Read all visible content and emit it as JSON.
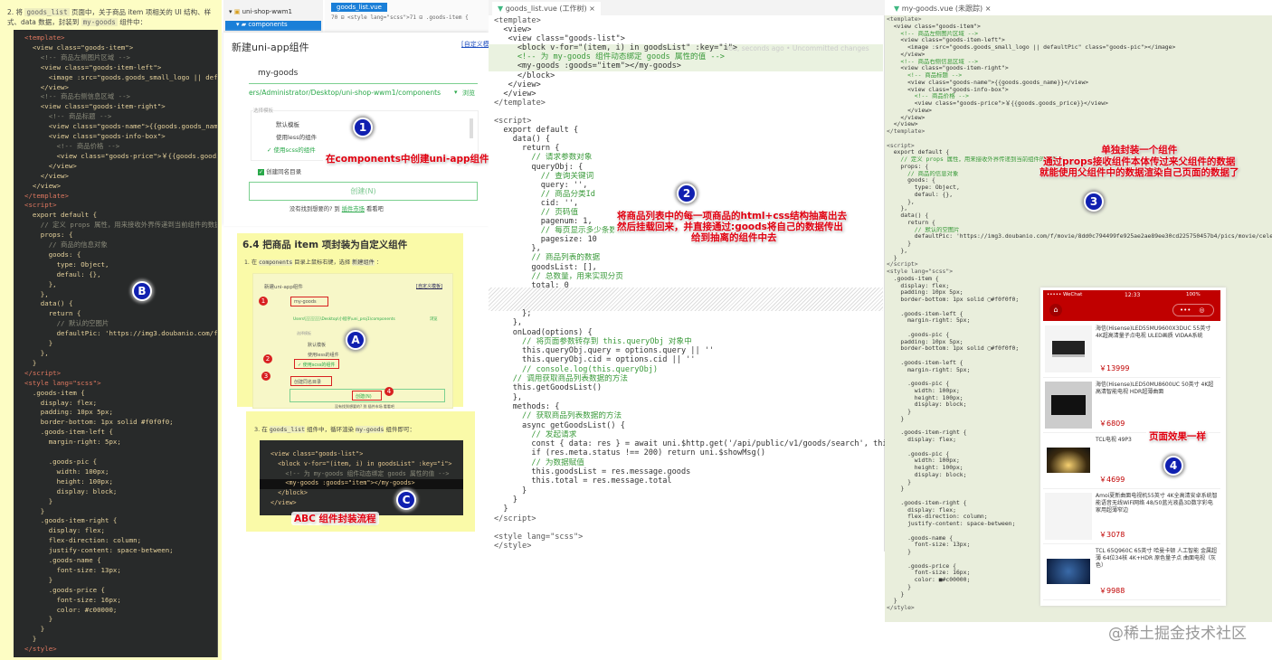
{
  "panel_b": {
    "intro_prefix": "2. 将",
    "intro_code1": "goods_list",
    "intro_mid": "页面中，关于商品 item 项相关的 UI 结构、样式、data 数据，封装到",
    "intro_code2": "my-goods",
    "intro_suffix": "组件中：",
    "badge": "B",
    "code": [
      "<template>",
      "  <view class=\"goods-item\">",
      "    <!-- 商品左侧图片区域 -->",
      "    <view class=\"goods-item-left\">",
      "      <image :src=\"goods.goods_small_logo || defaultPic\" class=\"goods-pic\"></image>",
      "    </view>",
      "    <!-- 商品右侧信息区域 -->",
      "    <view class=\"goods-item-right\">",
      "      <!-- 商品标题 -->",
      "      <view class=\"goods-name\">{{goods.goods_name}}</view>",
      "      <view class=\"goods-info-box\">",
      "        <!-- 商品价格 -->",
      "        <view class=\"goods-price\">￥{{goods.goods_price}}</view>",
      "      </view>",
      "    </view>",
      "  </view>",
      "</template>",
      "<script>",
      "  export default {",
      "    // 定义 props 属性，用来接收外界传递到当前组件的数据",
      "    props: {",
      "      // 商品的信息对象",
      "      goods: {",
      "        type: Object,",
      "        defaul: {},",
      "      },",
      "    },",
      "    data() {",
      "      return {",
      "        // 默认的空图片",
      "        defaultPic: 'https://img3.doubanio.com/f/movie/...'",
      "      }",
      "    },",
      "  }",
      "</script>",
      "<style lang=\"scss\">",
      "  .goods-item {",
      "    display: flex;",
      "    padding: 10px 5px;",
      "    border-bottom: 1px solid #f0f0f0;",
      "    .goods-item-left {",
      "      margin-right: 5px;",
      "",
      "      .goods-pic {",
      "        width: 100px;",
      "        height: 100px;",
      "        display: block;",
      "      }",
      "    }",
      "    .goods-item-right {",
      "      display: flex;",
      "      flex-direction: column;",
      "      justify-content: space-between;",
      "      .goods-name {",
      "        font-size: 13px;",
      "      }",
      "      .goods-price {",
      "        font-size: 16px;",
      "        color: #c00000;",
      "      }",
      "    }",
      "  }",
      "</style>"
    ]
  },
  "panel_1": {
    "project": "uni-shop-wwm1",
    "folder": "components",
    "file_tab": "goods_list.vue",
    "bg_code": [
      "70 ⊟ <style lang=\"scss\">",
      "71 ⊟ .goods-item {"
    ],
    "dialog_title": "新建uni-app组件",
    "custom_template": "[自定义模板]",
    "name_value": "my-goods",
    "path_value": "ers/Administrator/Desktop/uni-shop-wwm1/components",
    "browse": "浏览",
    "template_legend": "选择模板",
    "templates": [
      "默认模板",
      "使用less的组件",
      "使用scss的组件"
    ],
    "selected_mark": "✓",
    "checkbox_label": "创建同名目录",
    "create_button": "创建(N)",
    "footer_prefix": "没有找到想要的? 到",
    "footer_link": "插件市场",
    "footer_suffix": "看看吧",
    "badge": "1",
    "callout": "在components中创建uni-app组件"
  },
  "panel_a": {
    "heading": "6.4 把商品 item 项封装为自定义组件",
    "step_prefix": "1. 在",
    "step_code1": "components",
    "step_mid": "目录上鼠标右键，选择",
    "step_code2": "新建组件",
    "step_suffix": "：",
    "dialog_title": "新建uni-app组件",
    "custom_template": "[自定义模板]",
    "name_value": "my-goods",
    "path_value": "Users\\░░░░░\\Desktop\\小程序\\uni_proj1\\components",
    "browse": "浏览",
    "template_legend": "选择模板",
    "templates": [
      "默认模板",
      "使用less的组件",
      "✓ 使用scss的组件"
    ],
    "checkbox_label": "创建同名目录",
    "create_button": "创建(N)",
    "footer": "没有找到想要的? 到 插件市场 看看吧",
    "markers": [
      "1",
      "2",
      "3",
      "4"
    ],
    "badge": "A"
  },
  "panel_c": {
    "step_prefix": "3. 在",
    "step_code1": "goods_list",
    "step_mid": "组件中，循环渲染",
    "step_code2": "my-goods",
    "step_suffix": "组件即可：",
    "code": [
      "<view class=\"goods-list\">",
      "  <block v-for=\"(item, i) in goodsList\" :key=\"i\">",
      "    <!-- 为 my-goods 组件动态绑定 goods 属性的值 -->",
      "    <my-goods :goods=\"item\"></my-goods>",
      "  </block>",
      "</view>"
    ],
    "badge": "C",
    "callout_abc": "ABC",
    "callout": "组件封装流程"
  },
  "panel_2": {
    "tab": "goods_list.vue (工作树)",
    "blame": "You, seconds ago • Uncommitted changes",
    "code_top": [
      "<template>",
      "  <view>",
      "   <view class=\"goods-list\">",
      "     <block v-for=\"(item, i) in goodsList\" :key=\"i\">",
      "     <!-- 为 my-goods 组件动态绑定 goods 属性的值 -->",
      "     <my-goods :goods=\"item\"></my-goods>",
      "     </block>",
      "   </view>",
      "  </view>",
      "</template>",
      "",
      "<script>",
      "  export default {",
      "    data() {",
      "      return {",
      "        // 请求参数对象",
      "        queryObj: {",
      "          // 查询关键词",
      "          query: '',",
      "          // 商品分类Id",
      "          cid: '',",
      "          // 页码值",
      "          pagenum: 1,",
      "          // 每页显示多少条数据",
      "          pagesize: 10",
      "        },",
      "        // 商品列表的数据",
      "        goodsList: [],",
      "        // 总数量，用来实现分页",
      "        total: 0"
    ],
    "code_bottom": [
      "      };",
      "    },",
      "    onLoad(options) {",
      "      // 将页面参数转存到 this.queryObj 对象中",
      "      this.queryObj.query = options.query || ''",
      "      this.queryObj.cid = options.cid || ''",
      "      // console.log(this.queryObj)",
      "    // 调用获取商品列表数据的方法",
      "    this.getGoodsList()",
      "    },",
      "    methods: {",
      "      // 获取商品列表数据的方法",
      "      async getGoodsList() {",
      "        // 发起请求",
      "        const { data: res } = await uni.$http.get('/api/public/v1/goods/search', this.queryObj)",
      "        if (res.meta.status !== 200) return uni.$showMsg()",
      "        // 为数据赋值",
      "        this.goodsList = res.message.goods",
      "        this.total = res.message.total",
      "      }",
      "    }",
      "  }",
      "</script>",
      "",
      "<style lang=\"scss\">",
      "</style>"
    ],
    "badge": "2",
    "callout": [
      "将商品列表中的每一项商品的html+css结构抽离出去",
      "然后挂载回来，并直接通过:goods将自己的数据传出",
      "给到抽离的组件中去"
    ]
  },
  "panel_3": {
    "tab": "my-goods.vue (未跟踪)",
    "code": [
      "<template>",
      "  <view class=\"goods-item\">",
      "    <!-- 商品左侧图片区域 -->",
      "    <view class=\"goods-item-left\">",
      "      <image :src=\"goods.goods_small_logo || defaultPic\" class=\"goods-pic\"></image>",
      "    </view>",
      "    <!-- 商品右侧信息区域 -->",
      "    <view class=\"goods-item-right\">",
      "      <!-- 商品标题 -->",
      "      <view class=\"goods-name\">{{goods.goods_name}}</view>",
      "      <view class=\"goods-info-box\">",
      "        <!-- 商品价格 -->",
      "        <view class=\"goods-price\">￥{{goods.goods_price}}</view>",
      "      </view>",
      "    </view>",
      "  </view>",
      "</template>",
      "",
      "<script>",
      "  export default {",
      "    // 定义 props 属性，用来接收外界传递到当前组件的数据",
      "    props: {",
      "      // 商品的信息对象",
      "      goods: {",
      "        type: Object,",
      "        defaul: {},",
      "      },",
      "    },",
      "    data() {",
      "      return {",
      "        // 默认的空图片",
      "        defaultPic: 'https://img3.doubanio.com/f/movie/8dd0c794499fe925ae2ae89ee30cd225750457b4/pics/movie/celebrity-default",
      "      }",
      "    },",
      "  }",
      "</script>",
      "<style lang=\"scss\">",
      "  .goods-item {",
      "    display: flex;",
      "    padding: 10px 5px;",
      "    border-bottom: 1px solid ▢#f0f0f0;",
      "",
      "    .goods-item-left {",
      "      margin-right: 5px;",
      "",
      "      .goods-pic {",
      "    padding: 10px 5px;",
      "    border-bottom: 1px solid ▢#f0f0f0;",
      "",
      "    .goods-item-left {",
      "      margin-right: 5px;",
      "",
      "      .goods-pic {",
      "        width: 100px;",
      "        height: 100px;",
      "        display: block;",
      "      }",
      "    }",
      "",
      "    .goods-item-right {",
      "      display: flex;",
      "",
      "      .goods-pic {",
      "        width: 100px;",
      "        height: 100px;",
      "        display: block;",
      "      }",
      "    }",
      "",
      "    .goods-item-right {",
      "      display: flex;",
      "      flex-direction: column;",
      "      justify-content: space-between;",
      "",
      "      .goods-name {",
      "        font-size: 13px;",
      "      }",
      "",
      "      .goods-price {",
      "        font-size: 16px;",
      "        color: ■#c00000;",
      "      }",
      "    }",
      "  }",
      "</style>"
    ],
    "badge": "3",
    "callout": [
      "单独封装一个组件",
      "通过props接收组件本体传过来父组件的数据",
      "就能使用父组件中的数据渲染自己页面的数据了"
    ]
  },
  "phone": {
    "carrier": "••••• WeChat",
    "time": "12:33",
    "battery": "100%",
    "items": [
      {
        "name": "海信(Hisense)LED55MU9600X3DUC 55英寸 4K超高清量子点电视 ULED画质 VIDAA系统",
        "price": "￥13999"
      },
      {
        "name": "海信(Hisense)LED50MU8600UC 50英寸 4K超高清智能电视 HDR超薄曲面",
        "price": "￥6809"
      },
      {
        "name": "TCL电视 49P3",
        "price": "￥4699"
      },
      {
        "name": "Amoi夏新曲面电视机55英寸 4K全高清安卓系统智能语音无线WiFi网络 48/50蓝光液晶3D数字彩电 家用超薄窄边",
        "price": "￥3078"
      },
      {
        "name": "TCL 65Q960C 65英寸 哈曼卡顿 人工智能 金属超薄 64位34核 4K+HDR 原色量子点 曲面电视（灰色）",
        "price": "￥9988"
      }
    ],
    "badge": "4",
    "callout": "页面效果一样"
  },
  "watermark": "@稀土掘金技术社区",
  "colors": {
    "accent_red": "#c00000",
    "callout_red": "#e00010",
    "badge_blue": "#1020b0",
    "note_yellow": "#fafaa8",
    "green": "#2aa84a"
  }
}
